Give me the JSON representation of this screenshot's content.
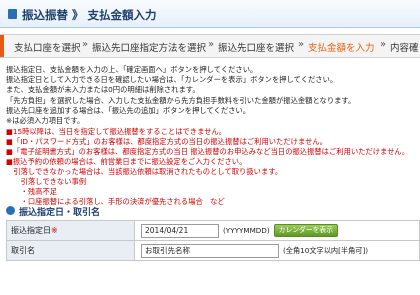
{
  "page_title": "振込振替 》 支払金額入力",
  "steps": [
    "支払口座を選択",
    "振込先口座指定方法を選択",
    "振込先口座を選択",
    "支払金額を入力",
    "内容確"
  ],
  "step_separator": "»",
  "info_lines": [
    "振込指定日、支払金額を入力の上、「確定画面へ」ボタンを押してください。",
    "振込指定日として入力できる日を確認したい場合は、「カレンダーを表示」ボタンを押してください。",
    "また、支払金額が未入力または0円の明細は削除されます。",
    "「先方負担」を選択した場合、入力した支払金額から先方負担手数料を引いた金額が振込金額となります。",
    "振込先口座を追加する場合は、「振込先の追加」ボタンを押してください。",
    "※は必須入力項目です。"
  ],
  "warning_lines": [
    "■15時以降は、当日を指定して振込振替をすることはできません。",
    "■「ID・パスワード方式」のお客様は、都度指定方式の当日の振込振替はご利用いただけません。",
    "■「電子証明書方式」のお客様は、都度指定方式の当日 振込振替のお申込みなど当日の振込振替はご利用いただけません。",
    "■振込予約の依頼の場合は、前営業日までに振込設定をご入力ください。",
    "　引落しできなかった場合は、当該振込依頼は取消されたものとして取り扱います。",
    "　　引落しできない事例",
    "　　・残高不足",
    "　　・口座振替による引落し、手形の決済が優先される場合　など"
  ],
  "section_title": "振込指定日・取引名",
  "form": {
    "date_label": "振込指定日",
    "required_mark": "※",
    "date_value": "2014/04/21",
    "date_format_hint": "(YYYYMMDD)",
    "calendar_button": "カレンダーを表示",
    "name_label": "取引名",
    "name_value": "お取引先名称",
    "name_hint": "(全角10文字以内[半角可])"
  },
  "colors": {
    "accent_orange": "#e8600e",
    "warning_red": "#d40000",
    "title_blue": "#1f3f6f",
    "button_green": "#5e9a24"
  }
}
